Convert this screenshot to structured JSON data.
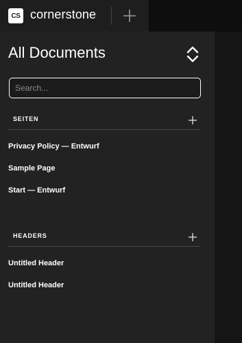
{
  "app": {
    "logo_text": "CS",
    "brand": "cornerstone"
  },
  "sidebar": {
    "title": "All Documents",
    "search": {
      "placeholder": "Search...",
      "value": ""
    },
    "sections": [
      {
        "label": "SEITEN",
        "items": [
          "Privacy Policy — Entwurf",
          "Sample Page",
          "Start — Entwurf"
        ]
      },
      {
        "label": "HEADERS",
        "items": [
          "Untitled Header",
          "Untitled Header"
        ]
      }
    ]
  },
  "icons": {
    "top_add": "plus-icon",
    "sort": "chevron-up-down-icon",
    "section_add": "plus-icon"
  },
  "colors": {
    "background": "#1a1a1a",
    "panel": "#222222",
    "text": "#ffffff",
    "divider": "#4a4a4a"
  }
}
